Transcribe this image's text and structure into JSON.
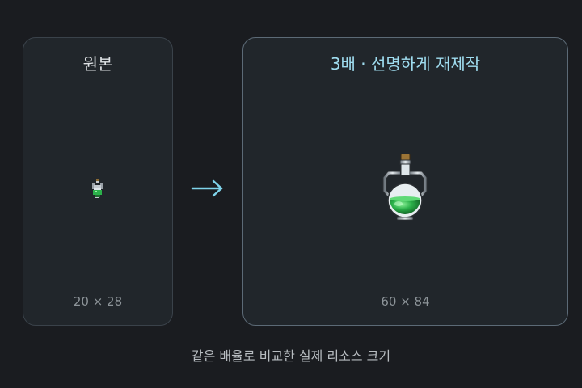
{
  "original": {
    "title": "원본",
    "size": "20 × 28"
  },
  "remake": {
    "title": "3배 · 선명하게 재제작",
    "size": "60 × 84"
  },
  "footer": "같은 배율로 비교한 실제 리소스 크기",
  "sprite_icon": "green-potion-flask-icon",
  "arrow_icon": "right-arrow-icon",
  "colors": {
    "background": "#1a1c20",
    "panel": "#21262b",
    "accent": "#9fdcef",
    "potion": "#2bb14a"
  }
}
